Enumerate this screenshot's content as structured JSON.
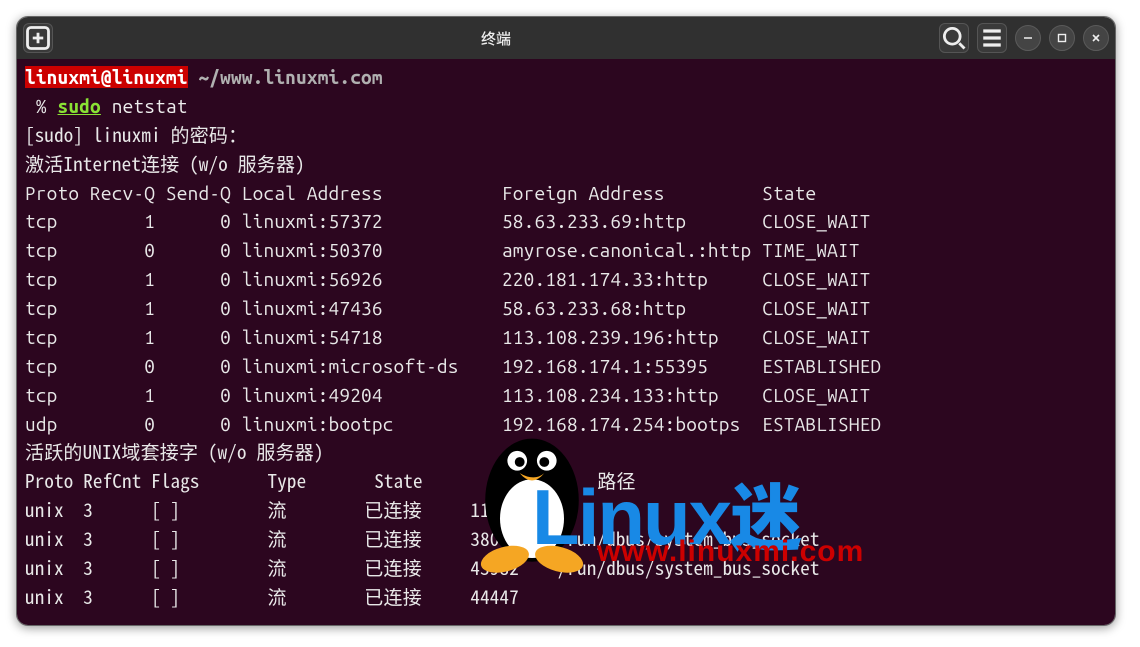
{
  "titlebar": {
    "title": "终端",
    "new_tab": "+",
    "search": "search",
    "menu": "menu",
    "minimize": "−",
    "maximize": "□",
    "close": "×"
  },
  "prompt": {
    "userhost": "linuxmi@linuxmi",
    "path": "~/www.linuxmi.com",
    "symbol": "%",
    "cmd_sudo": "sudo",
    "cmd_args": "netstat"
  },
  "output": {
    "sudo_prompt": "[sudo] linuxmi 的密码：",
    "inet_header": "激活Internet连接 (w/o 服务器)",
    "inet_cols": "Proto Recv-Q Send-Q Local Address           Foreign Address         State",
    "inet_rows": [
      "tcp        1      0 linuxmi:57372           58.63.233.69:http       CLOSE_WAIT",
      "tcp        0      0 linuxmi:50370           amyrose.canonical.:http TIME_WAIT",
      "tcp        1      0 linuxmi:56926           220.181.174.33:http     CLOSE_WAIT",
      "tcp        1      0 linuxmi:47436           58.63.233.68:http       CLOSE_WAIT",
      "tcp        1      0 linuxmi:54718           113.108.239.196:http    CLOSE_WAIT",
      "tcp        0      0 linuxmi:microsoft-ds    192.168.174.1:55395     ESTABLISHED",
      "tcp        1      0 linuxmi:49204           113.108.234.133:http    CLOSE_WAIT",
      "udp        0      0 linuxmi:bootpc          192.168.174.254:bootps  ESTABLISHED"
    ],
    "unix_header": "活跃的UNIX域套接字 (w/o 服务器)",
    "unix_cols": "Proto RefCnt Flags       Type       State         I-Node   路径",
    "unix_rows": [
      "unix  3      [ ]         流        已连接     119698   ",
      "unix  3      [ ]         流        已连接     38062    /run/dbus/system_bus_socket",
      "unix  3      [ ]         流        已连接     43982    /run/dbus/system_bus_socket",
      "unix  3      [ ]         流        已连接     44447    "
    ]
  },
  "watermark": {
    "text_linux": "Linux",
    "text_mi": "迷",
    "url": "www.linuxmi.com"
  }
}
